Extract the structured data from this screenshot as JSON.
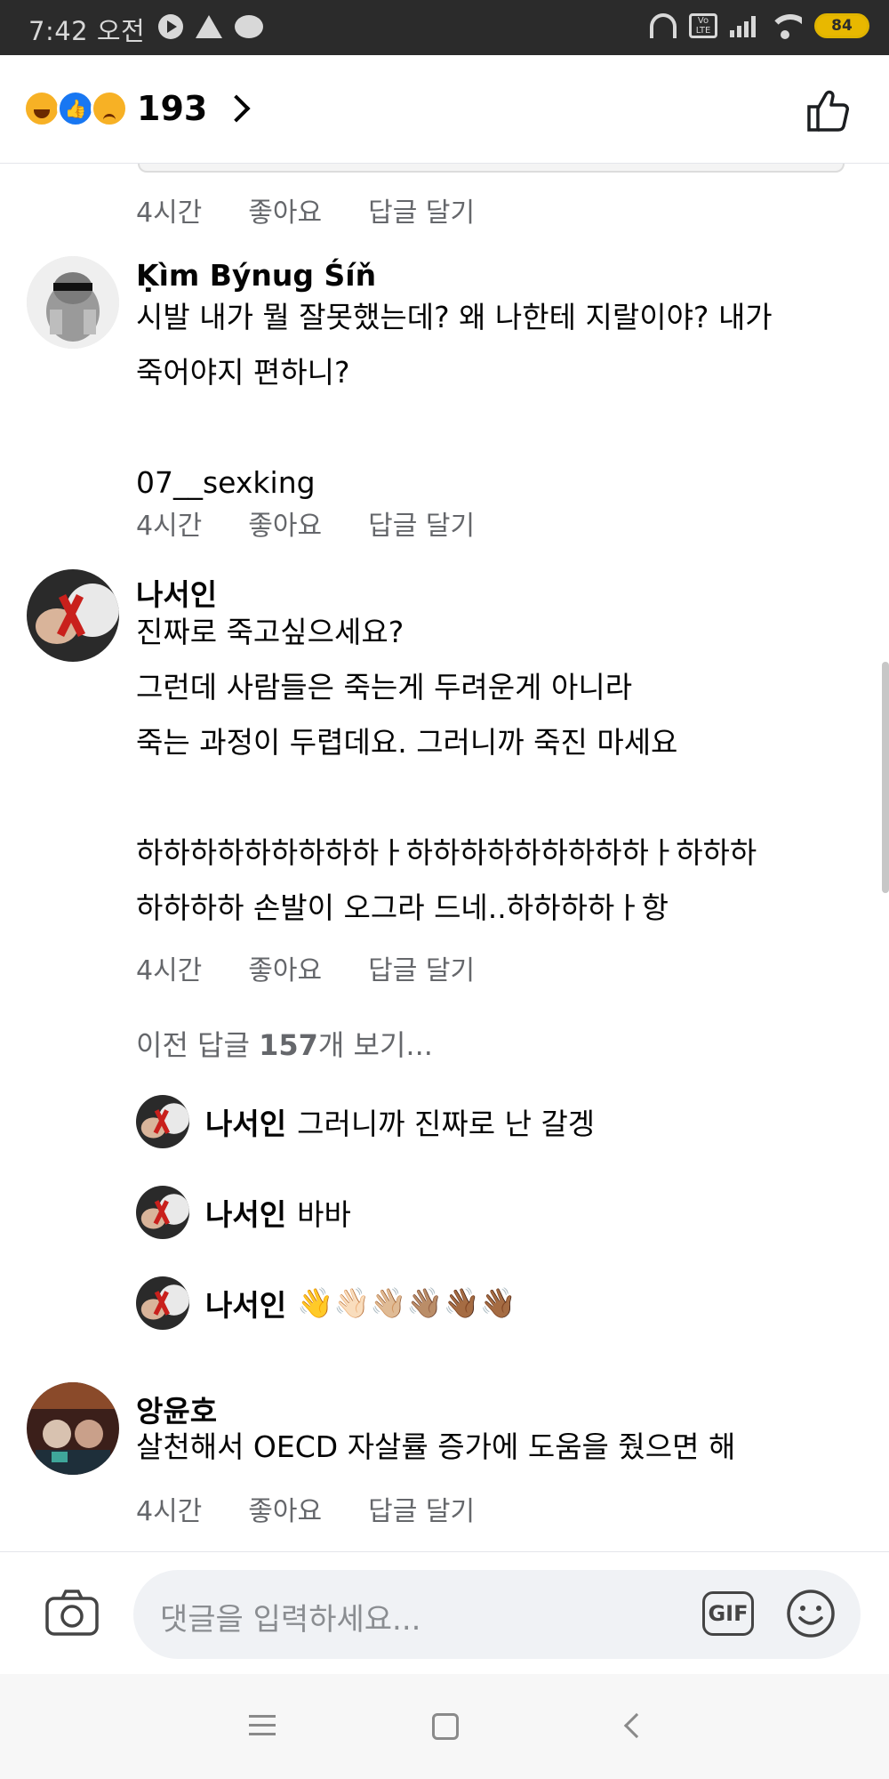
{
  "status_bar": {
    "time": "7:42 오전",
    "battery": "84"
  },
  "header": {
    "reaction_count": "193"
  },
  "comments": [
    {
      "meta": {
        "time": "4시간",
        "like": "좋아요",
        "reply": "답글 달기"
      }
    },
    {
      "author": "Ḳìm Býnug Śíň",
      "text": "시발 내가 뭘 잘못했는데? 왜 나한테 지랄이야? 내가\n죽어야지 편하니?\n\n07__sexking",
      "meta": {
        "time": "4시간",
        "like": "좋아요",
        "reply": "답글 달기"
      }
    },
    {
      "author": "나서인",
      "text": "진짜로 죽고싶으세요?\n그런데 사람들은 죽는게 두려운게 아니라\n죽는 과정이 두렵데요. 그러니까 죽진 마세요\n\n하하하하하하하하하ㅏ하하하하하하하하하ㅏ하하하\n하하하하 손발이 오그라 드네..하하하하ㅏ항",
      "meta": {
        "time": "4시간",
        "like": "좋아요",
        "reply": "답글 달기"
      }
    },
    {
      "author": "앙윤호",
      "text": "살천해서 OECD 자살률 증가에 도움을 줬으면 해",
      "meta": {
        "time": "4시간",
        "like": "좋아요",
        "reply": "답글 달기"
      }
    }
  ],
  "previous_replies": {
    "prefix": "이전 답글 ",
    "count": "157",
    "suffix": "개 보기..."
  },
  "replies": [
    {
      "author": "나서인",
      "text": "그러니까 진짜로 난 갈겡"
    },
    {
      "author": "나서인",
      "text": "바바"
    },
    {
      "author": "나서인",
      "text": "👋👋🏻👋🏼👋🏽👋🏾👋🏾"
    }
  ],
  "composer": {
    "placeholder": "댓글을 입력하세요...",
    "gif_label": "GIF"
  },
  "colors": {
    "brand_blue": "#1877f2",
    "meta_gray": "#65676b",
    "status_bar_bg": "#2b2b2b",
    "battery_yellow": "#e8b800"
  }
}
